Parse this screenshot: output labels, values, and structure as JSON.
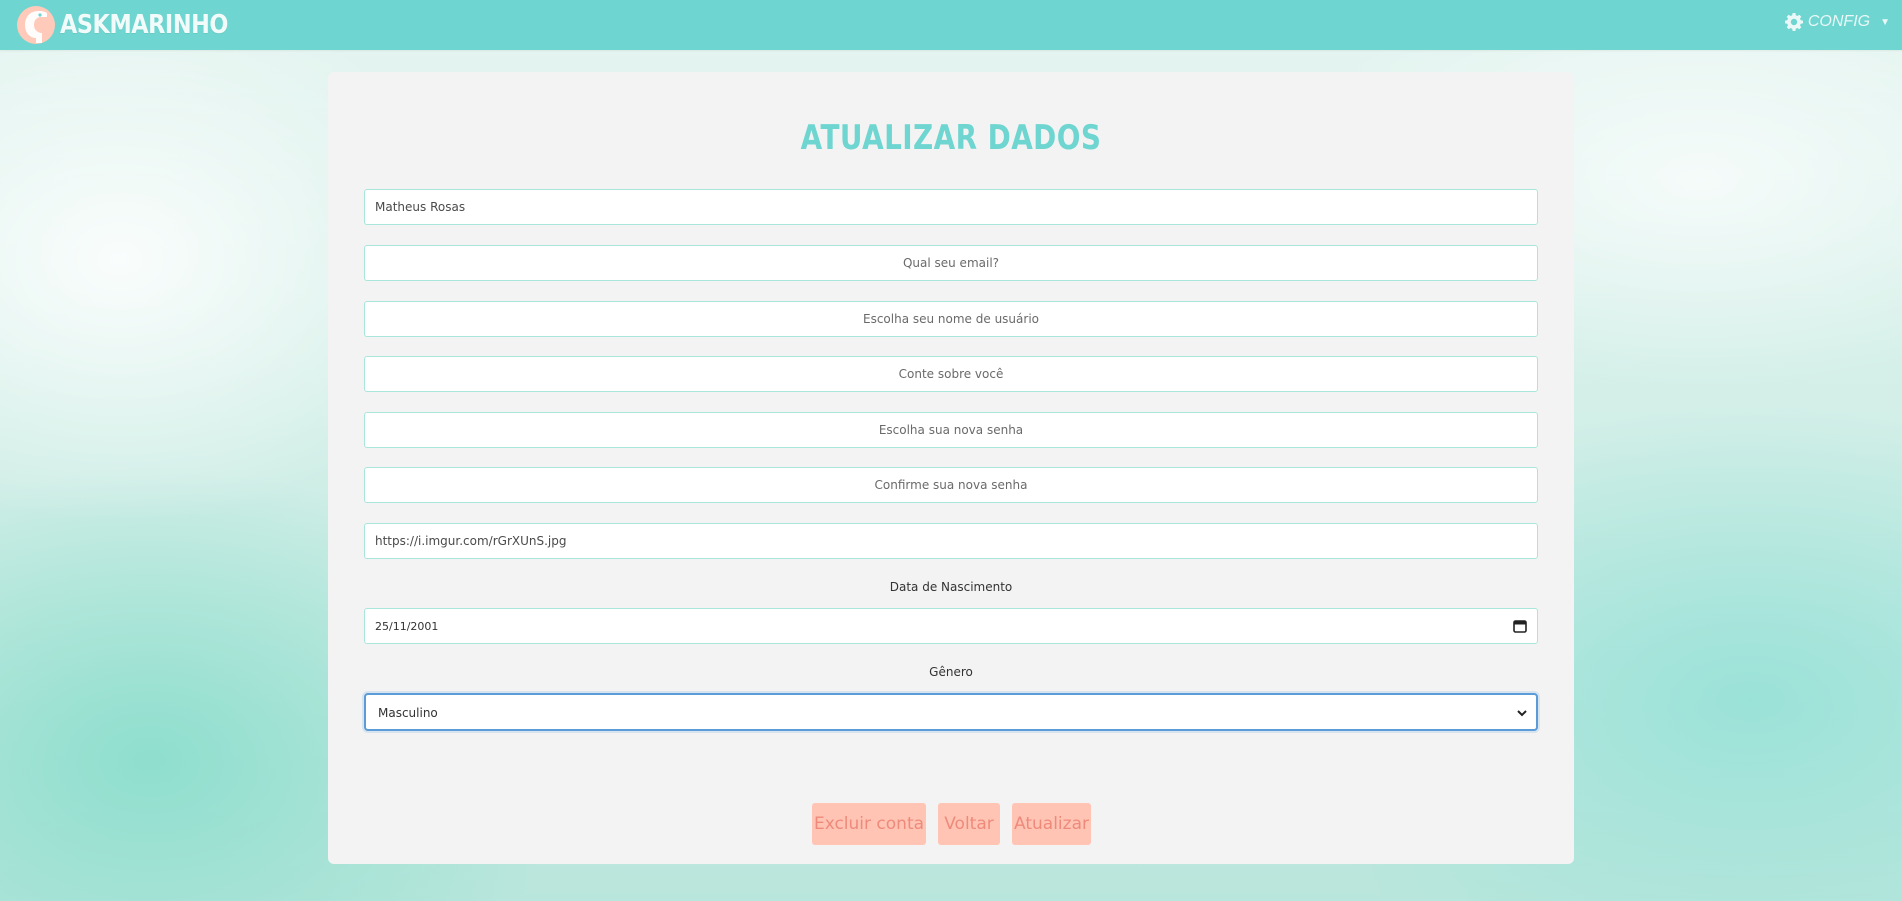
{
  "header": {
    "brand": "ASKMARINHO",
    "config_label": "CONFIG",
    "icons": {
      "logo": "seahorse-logo-icon",
      "config": "gear-icon",
      "caret": "caret-down-icon"
    }
  },
  "form": {
    "title": "ATUALIZAR DADOS",
    "name_value": "Matheus Rosas",
    "email_placeholder": "Qual seu email?",
    "username_placeholder": "Escolha seu nome de usuário",
    "bio_placeholder": "Conte sobre você",
    "new_password_placeholder": "Escolha sua nova senha",
    "confirm_password_placeholder": "Confirme sua nova senha",
    "avatar_url_value": "https://i.imgur.com/rGrXUnS.jpg",
    "birthdate_label": "Data de Nascimento",
    "birthdate_value": "25/11/2001",
    "gender_label": "Gênero",
    "gender_value": "Masculino"
  },
  "buttons": {
    "delete": "Excluir conta",
    "back": "Voltar",
    "update": "Atualizar"
  },
  "colors": {
    "accent": "#6fd5d0",
    "button_bg": "#ffc4b4",
    "button_text": "#ef8a7b",
    "card_bg": "#f3f3f3",
    "focus_border": "#5b9bd8"
  }
}
